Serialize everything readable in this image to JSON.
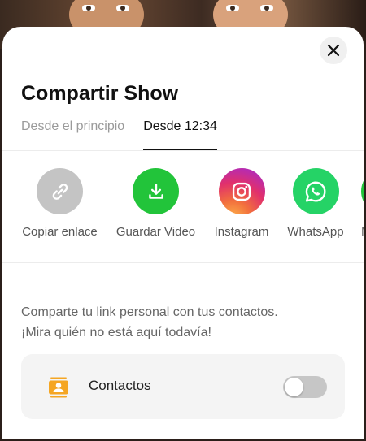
{
  "sheet": {
    "title": "Compartir Show",
    "close_icon": "close-icon"
  },
  "tabs": [
    {
      "label": "Desde el principio",
      "active": false
    },
    {
      "label": "Desde 12:34",
      "active": true
    }
  ],
  "share_options": [
    {
      "label": "Copiar enlace",
      "icon": "link-icon",
      "color": "#c4c4c4"
    },
    {
      "label": "Guardar Video",
      "icon": "download-icon",
      "color": "#22c43a"
    },
    {
      "label": "Instagram",
      "icon": "instagram-icon",
      "color": "#e1306c"
    },
    {
      "label": "WhatsApp",
      "icon": "whatsapp-icon",
      "color": "#25d366"
    },
    {
      "label": "M",
      "icon": "more-app-icon",
      "color": "#22c43a"
    }
  ],
  "description": {
    "line1": "Comparte tu link personal con tus contactos.",
    "line2": "¡Mira quién no está aquí todavía!"
  },
  "contacts": {
    "label": "Contactos",
    "icon": "contacts-icon",
    "icon_color": "#f5a623",
    "toggle_on": false
  }
}
